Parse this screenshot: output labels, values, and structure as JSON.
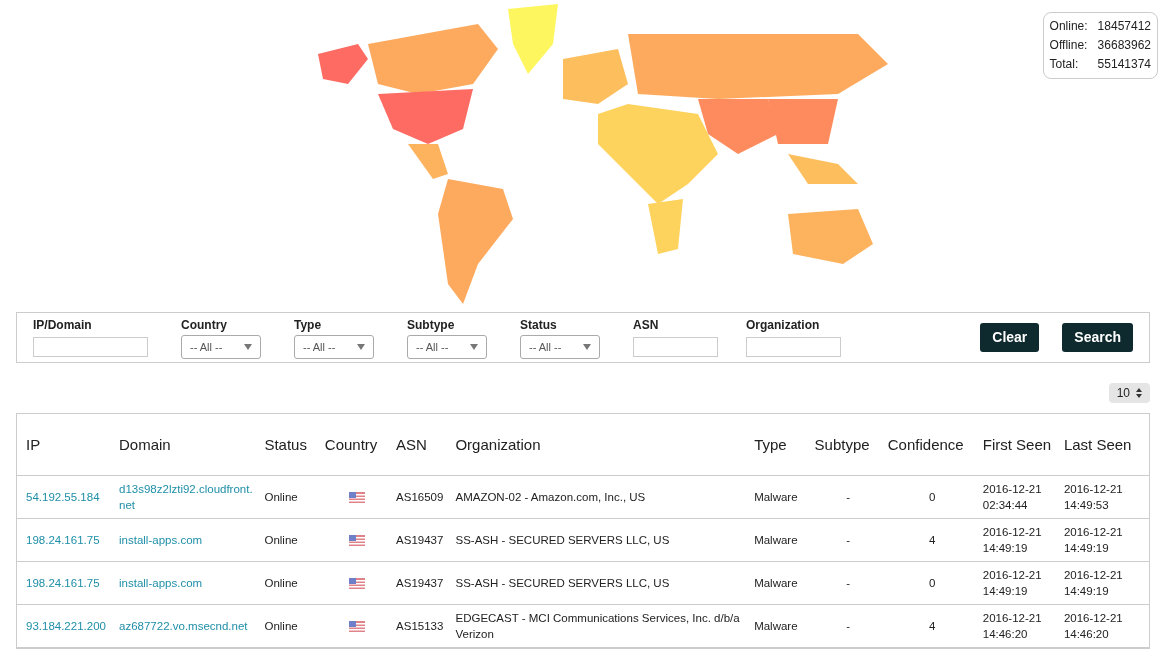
{
  "stats": [
    {
      "label": "Online:",
      "value": "18457412"
    },
    {
      "label": "Offline:",
      "value": "36683962"
    },
    {
      "label": "Total:",
      "value": "55141374"
    }
  ],
  "filters": [
    {
      "kind": "text",
      "label": "IP/Domain"
    },
    {
      "kind": "select",
      "label": "Country",
      "value": "-- All --"
    },
    {
      "kind": "select",
      "label": "Type",
      "value": "-- All --"
    },
    {
      "kind": "select",
      "label": "Subtype",
      "value": "-- All --"
    },
    {
      "kind": "select",
      "label": "Status",
      "value": "-- All --"
    },
    {
      "kind": "text",
      "label": "ASN"
    },
    {
      "kind": "text",
      "label": "Organization"
    }
  ],
  "buttons": [
    "Clear",
    "Search"
  ],
  "page_size": "10",
  "table": {
    "columns": [
      "IP",
      "Domain",
      "Status",
      "Country",
      "ASN",
      "Organization",
      "Type",
      "Subtype",
      "Confidence",
      "First Seen",
      "Last Seen"
    ],
    "rows": [
      {
        "ip": "54.192.55.184",
        "domain": "d13s98z2lzti92.cloudfront.net",
        "status": "Online",
        "asn": "AS16509",
        "organization": "AMAZON-02 - Amazon.com, Inc., US",
        "type": "Malware",
        "subtype": "-",
        "confidence": "0",
        "first_seen": "2016-12-21 02:34:44",
        "last_seen": "2016-12-21 14:49:53"
      },
      {
        "ip": "198.24.161.75",
        "domain": "install-apps.com",
        "status": "Online",
        "asn": "AS19437",
        "organization": "SS-ASH - SECURED SERVERS LLC, US",
        "type": "Malware",
        "subtype": "-",
        "confidence": "4",
        "first_seen": "2016-12-21 14:49:19",
        "last_seen": "2016-12-21 14:49:19"
      },
      {
        "ip": "198.24.161.75",
        "domain": "install-apps.com",
        "status": "Online",
        "asn": "AS19437",
        "organization": "SS-ASH - SECURED SERVERS LLC, US",
        "type": "Malware",
        "subtype": "-",
        "confidence": "0",
        "first_seen": "2016-12-21 14:49:19",
        "last_seen": "2016-12-21 14:49:19"
      },
      {
        "ip": "93.184.221.200",
        "domain": "az687722.vo.msecnd.net",
        "status": "Online",
        "asn": "AS15133",
        "organization": "EDGECAST - MCI Communications Services, Inc. d/b/a Verizon",
        "type": "Malware",
        "subtype": "-",
        "confidence": "4",
        "first_seen": "2016-12-21 14:46:20",
        "last_seen": "2016-12-21 14:46:20"
      }
    ]
  }
}
